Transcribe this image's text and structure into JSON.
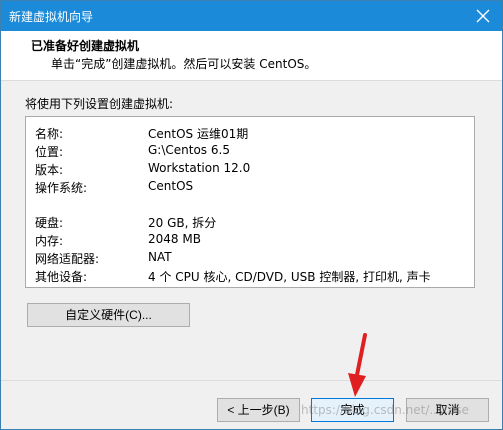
{
  "window": {
    "title": "新建虚拟机向导"
  },
  "header": {
    "title": "已准备好创建虚拟机",
    "subtitle": "单击“完成”创建虚拟机。然后可以安装 CentOS。"
  },
  "intro": "将使用下列设置创建虚拟机:",
  "summary": [
    {
      "k": "名称:",
      "v": "CentOS 运维01期"
    },
    {
      "k": "位置:",
      "v": "G:\\Centos 6.5"
    },
    {
      "k": "版本:",
      "v": "Workstation 12.0"
    },
    {
      "k": "操作系统:",
      "v": "CentOS"
    },
    {
      "k": "硬盘:",
      "v": "20 GB, 拆分"
    },
    {
      "k": "内存:",
      "v": "2048 MB"
    },
    {
      "k": "网络适配器:",
      "v": "NAT"
    },
    {
      "k": "其他设备:",
      "v": "4 个 CPU 核心, CD/DVD, USB 控制器, 打印机, 声卡"
    }
  ],
  "buttons": {
    "customize": "自定义硬件(C)...",
    "back": "< 上一步(B)",
    "finish": "完成",
    "cancel": "取消"
  },
  "watermark": "https://blog.csdn.net/...xase",
  "colors": {
    "titlebar": "#1a8ad9",
    "arrow": "#e02020"
  },
  "icons": {
    "close": "close-icon",
    "pointer": "red-arrow-icon"
  }
}
